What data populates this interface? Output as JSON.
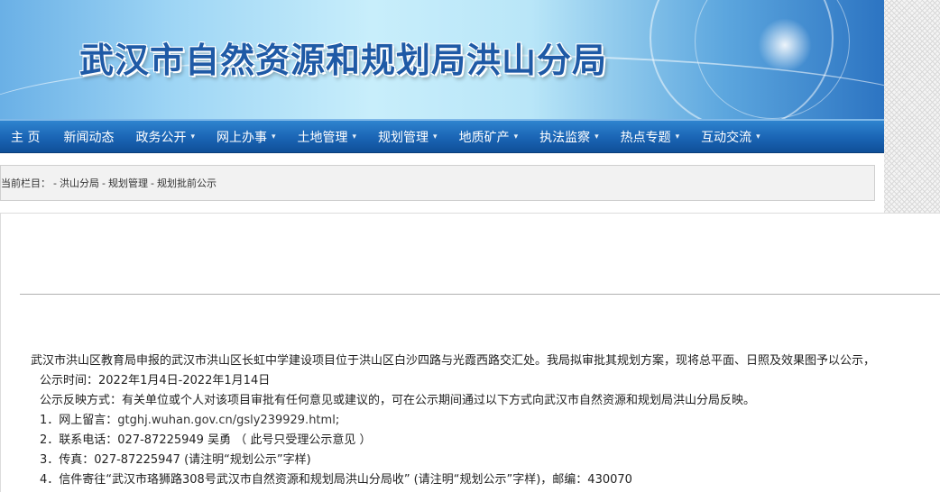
{
  "banner": {
    "title": "武汉市自然资源和规划局洪山分局"
  },
  "nav": {
    "items": [
      {
        "label": "主 页",
        "dropdown": false
      },
      {
        "label": "新闻动态",
        "dropdown": false
      },
      {
        "label": "政务公开",
        "dropdown": true
      },
      {
        "label": "网上办事",
        "dropdown": true
      },
      {
        "label": "土地管理",
        "dropdown": true
      },
      {
        "label": "规划管理",
        "dropdown": true
      },
      {
        "label": "地质矿产",
        "dropdown": true
      },
      {
        "label": "执法监察",
        "dropdown": true
      },
      {
        "label": "热点专题",
        "dropdown": true
      },
      {
        "label": "互动交流",
        "dropdown": true
      }
    ],
    "caret": "▾"
  },
  "breadcrumb": {
    "prefix": "当前栏目：",
    "sep": "-",
    "items": [
      "洪山分局",
      "规划管理",
      "规划批前公示"
    ]
  },
  "article": {
    "intro": "武汉市洪山区教育局申报的武汉市洪山区长虹中学建设项目位于洪山区白沙四路与光霞西路交汇处。我局拟审批其规划方案，现将总平面、日照及效果图予以公示，",
    "period": "公示时间：2022年1月4日-2022年1月14日",
    "feedback": "公示反映方式：有关单位或个人对该项目审批有任何意见或建议的，可在公示期间通过以下方式向武汉市自然资源和规划局洪山分局反映。",
    "online_label": "1．网上留言：",
    "online_link": "gtghj.wuhan.gov.cn/gsly239929.html",
    "online_suffix": ";",
    "phone": "2．联系电话：027-87225949 吴勇 （ 此号只受理公示意见 ）",
    "fax": "3．传真：027-87225947 (请注明“规划公示”字样)",
    "mail": "4．信件寄往“武汉市珞狮路308号武汉市自然资源和规划局洪山分局收” (请注明“规划公示”字样)，邮编：430070"
  }
}
